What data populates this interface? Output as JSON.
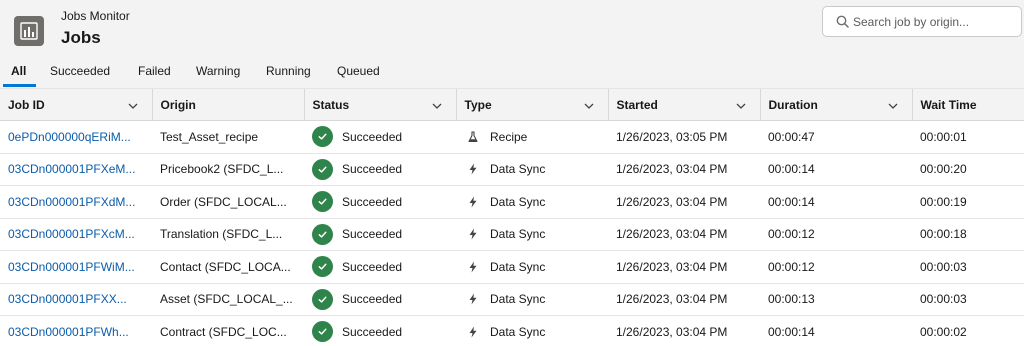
{
  "app": {
    "subtitle": "Jobs Monitor",
    "title": "Jobs"
  },
  "search": {
    "placeholder": "Search job by origin..."
  },
  "tabs": [
    {
      "label": "All",
      "active": true
    },
    {
      "label": "Succeeded",
      "active": false
    },
    {
      "label": "Failed",
      "active": false
    },
    {
      "label": "Warning",
      "active": false
    },
    {
      "label": "Running",
      "active": false
    },
    {
      "label": "Queued",
      "active": false
    }
  ],
  "table": {
    "columns": [
      {
        "label": "Job ID",
        "menu": true
      },
      {
        "label": "Origin",
        "menu": false
      },
      {
        "label": "Status",
        "menu": true
      },
      {
        "label": "Type",
        "menu": true
      },
      {
        "label": "Started",
        "menu": true
      },
      {
        "label": "Duration",
        "menu": true
      },
      {
        "label": "Wait Time",
        "menu": false
      }
    ],
    "rows": [
      {
        "job_id": "0ePDn000000qERiM...",
        "origin": "Test_Asset_recipe",
        "status": "Succeeded",
        "type": "Recipe",
        "type_icon": "flask-icon",
        "started": "1/26/2023, 03:05 PM",
        "duration": "00:00:47",
        "wait_time": "00:00:01"
      },
      {
        "job_id": "03CDn000001PFXeM...",
        "origin": "Pricebook2 (SFDC_L...",
        "status": "Succeeded",
        "type": "Data Sync",
        "type_icon": "lightning-icon",
        "started": "1/26/2023, 03:04 PM",
        "duration": "00:00:14",
        "wait_time": "00:00:20"
      },
      {
        "job_id": "03CDn000001PFXdM...",
        "origin": "Order (SFDC_LOCAL...",
        "status": "Succeeded",
        "type": "Data Sync",
        "type_icon": "lightning-icon",
        "started": "1/26/2023, 03:04 PM",
        "duration": "00:00:14",
        "wait_time": "00:00:19"
      },
      {
        "job_id": "03CDn000001PFXcM...",
        "origin": "Translation (SFDC_L...",
        "status": "Succeeded",
        "type": "Data Sync",
        "type_icon": "lightning-icon",
        "started": "1/26/2023, 03:04 PM",
        "duration": "00:00:12",
        "wait_time": "00:00:18"
      },
      {
        "job_id": "03CDn000001PFWiM...",
        "origin": "Contact (SFDC_LOCA...",
        "status": "Succeeded",
        "type": "Data Sync",
        "type_icon": "lightning-icon",
        "started": "1/26/2023, 03:04 PM",
        "duration": "00:00:12",
        "wait_time": "00:00:03"
      },
      {
        "job_id": "03CDn000001PFXX...",
        "origin": "Asset (SFDC_LOCAL_...",
        "status": "Succeeded",
        "type": "Data Sync",
        "type_icon": "lightning-icon",
        "started": "1/26/2023, 03:04 PM",
        "duration": "00:00:13",
        "wait_time": "00:00:03"
      },
      {
        "job_id": "03CDn000001PFWh...",
        "origin": "Contract (SFDC_LOC...",
        "status": "Succeeded",
        "type": "Data Sync",
        "type_icon": "lightning-icon",
        "started": "1/26/2023, 03:04 PM",
        "duration": "00:00:14",
        "wait_time": "00:00:02"
      }
    ]
  },
  "colors": {
    "link": "#0b5cab",
    "success": "#2e844a",
    "accent": "#0176d3",
    "header_bg": "#f3f3f3"
  }
}
